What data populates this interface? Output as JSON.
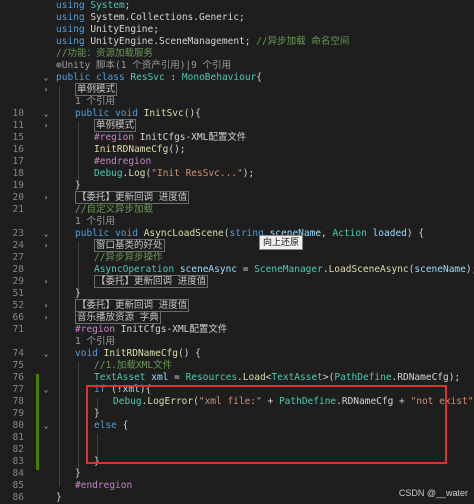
{
  "lines": [
    {
      "num": "",
      "fold": "",
      "indent": 0,
      "parts": [
        [
          "kw",
          "using"
        ],
        [
          "plain",
          " "
        ],
        [
          "ty",
          "System"
        ],
        [
          "plain",
          ";"
        ]
      ]
    },
    {
      "num": "",
      "fold": "",
      "indent": 0,
      "parts": [
        [
          "kw",
          "using"
        ],
        [
          "plain",
          " System.Collections.Generic;"
        ]
      ]
    },
    {
      "num": "",
      "fold": "",
      "indent": 0,
      "parts": [
        [
          "kw",
          "using"
        ],
        [
          "plain",
          " UnityEngine;"
        ]
      ]
    },
    {
      "num": "",
      "fold": "",
      "indent": 0,
      "parts": [
        [
          "kw",
          "using"
        ],
        [
          "plain",
          " UnityEngine.SceneManagement; "
        ],
        [
          "cm",
          "//异步加载 命名空间"
        ]
      ]
    },
    {
      "num": "",
      "fold": "",
      "indent": 0,
      "parts": [
        [
          "cm",
          "//功能：资源加载服务"
        ]
      ]
    },
    {
      "num": "",
      "fold": "",
      "indent": 0,
      "parts": [
        [
          "meta",
          "⊕Unity 脚本(1 个资产引用)|9 个引用"
        ]
      ]
    },
    {
      "num": "",
      "fold": "v",
      "indent": 0,
      "parts": [
        [
          "kw",
          "public"
        ],
        [
          "plain",
          " "
        ],
        [
          "kw",
          "class"
        ],
        [
          "plain",
          " "
        ],
        [
          "ty",
          "ResSvc"
        ],
        [
          "plain",
          " : "
        ],
        [
          "ty",
          "MonoBehaviour"
        ],
        [
          "plain",
          "{"
        ]
      ]
    },
    {
      "num": "",
      "fold": ">",
      "indent": 1,
      "parts": [
        [
          "boxed",
          "单例模式"
        ]
      ]
    },
    {
      "num": "",
      "fold": "",
      "indent": 1,
      "parts": [
        [
          "meta",
          "1 个引用"
        ]
      ]
    },
    {
      "num": "10",
      "fold": "v",
      "indent": 1,
      "parts": [
        [
          "kw",
          "public"
        ],
        [
          "plain",
          " "
        ],
        [
          "kw",
          "void"
        ],
        [
          "plain",
          " "
        ],
        [
          "fn",
          "InitSvc"
        ],
        [
          "plain",
          "(){"
        ]
      ]
    },
    {
      "num": "11",
      "fold": ">",
      "indent": 2,
      "parts": [
        [
          "boxed",
          "单例模式"
        ]
      ]
    },
    {
      "num": "15",
      "fold": "",
      "indent": 2,
      "parts": [
        [
          "pp",
          "#region"
        ],
        [
          "plain",
          " InitCfgs-XML配置文件"
        ]
      ]
    },
    {
      "num": "16",
      "fold": "",
      "indent": 2,
      "parts": [
        [
          "fn",
          "InitRDNameCfg"
        ],
        [
          "plain",
          "();"
        ]
      ]
    },
    {
      "num": "17",
      "fold": "",
      "indent": 2,
      "parts": [
        [
          "pp",
          "#endregion"
        ]
      ]
    },
    {
      "num": "18",
      "fold": "",
      "indent": 2,
      "parts": [
        [
          "ty",
          "Debug"
        ],
        [
          "plain",
          "."
        ],
        [
          "fn",
          "Log"
        ],
        [
          "plain",
          "("
        ],
        [
          "str",
          "\"Init ResSvc...\""
        ],
        [
          "plain",
          ");"
        ]
      ]
    },
    {
      "num": "19",
      "fold": "",
      "indent": 1,
      "parts": [
        [
          "plain",
          "}"
        ]
      ]
    },
    {
      "num": "20",
      "fold": ">",
      "indent": 1,
      "parts": [
        [
          "boxed",
          "【委托】更新回调 进度值"
        ]
      ]
    },
    {
      "num": "21",
      "fold": "",
      "indent": 1,
      "parts": [
        [
          "cm",
          "//自定义异步加载"
        ]
      ]
    },
    {
      "num": "",
      "fold": "",
      "indent": 1,
      "parts": [
        [
          "meta",
          "1 个引用"
        ]
      ]
    },
    {
      "num": "23",
      "fold": "v",
      "indent": 1,
      "parts": [
        [
          "kw",
          "public"
        ],
        [
          "plain",
          " "
        ],
        [
          "kw",
          "void"
        ],
        [
          "plain",
          " "
        ],
        [
          "fn",
          "AsyncLoadScene"
        ],
        [
          "plain",
          "("
        ],
        [
          "kw",
          "string"
        ],
        [
          "plain",
          " "
        ],
        [
          "id",
          "sceneName"
        ],
        [
          "plain",
          ", "
        ],
        [
          "ty",
          "Action"
        ],
        [
          "plain",
          " "
        ],
        [
          "id",
          "loaded"
        ],
        [
          "plain",
          ") {"
        ]
      ]
    },
    {
      "num": "24",
      "fold": ">",
      "indent": 2,
      "parts": [
        [
          "boxed",
          "窗口基类的好处"
        ]
      ]
    },
    {
      "num": "27",
      "fold": "",
      "indent": 2,
      "parts": [
        [
          "cm",
          "//异步异步操作"
        ]
      ]
    },
    {
      "num": "28",
      "fold": "",
      "indent": 2,
      "parts": [
        [
          "ty",
          "AsyncOperation"
        ],
        [
          "plain",
          " "
        ],
        [
          "id",
          "sceneAsync"
        ],
        [
          "plain",
          " = "
        ],
        [
          "ty",
          "SceneManager"
        ],
        [
          "plain",
          "."
        ],
        [
          "fn",
          "LoadSceneAsync"
        ],
        [
          "plain",
          "("
        ],
        [
          "id",
          "sceneName"
        ],
        [
          "plain",
          ");"
        ]
      ]
    },
    {
      "num": "29",
      "fold": ">",
      "indent": 2,
      "parts": [
        [
          "boxed",
          "【委托】更新回调 进度值"
        ]
      ]
    },
    {
      "num": "51",
      "fold": "",
      "indent": 1,
      "parts": [
        [
          "plain",
          "}"
        ]
      ]
    },
    {
      "num": "52",
      "fold": ">",
      "indent": 1,
      "parts": [
        [
          "boxed",
          "【委托】更新回调 进度值"
        ]
      ]
    },
    {
      "num": "66",
      "fold": ">",
      "indent": 1,
      "parts": [
        [
          "boxed",
          "音乐播放资源 字典"
        ]
      ]
    },
    {
      "num": "71",
      "fold": "",
      "indent": 1,
      "parts": [
        [
          "pp",
          "#region"
        ],
        [
          "plain",
          " InitCfgs-XML配置文件"
        ]
      ]
    },
    {
      "num": "",
      "fold": "",
      "indent": 1,
      "parts": [
        [
          "meta",
          "1 个引用"
        ]
      ]
    },
    {
      "num": "74",
      "fold": "v",
      "indent": 1,
      "parts": [
        [
          "kw",
          "void"
        ],
        [
          "plain",
          " "
        ],
        [
          "fn",
          "InitRDNameCfg"
        ],
        [
          "plain",
          "() {"
        ]
      ]
    },
    {
      "num": "75",
      "fold": "",
      "indent": 2,
      "parts": [
        [
          "cm",
          "//1.加载XML文件"
        ]
      ]
    },
    {
      "num": "76",
      "fold": "",
      "indent": 2,
      "parts": [
        [
          "ty",
          "TextAsset"
        ],
        [
          "plain",
          " "
        ],
        [
          "id",
          "xml"
        ],
        [
          "plain",
          " = "
        ],
        [
          "ty",
          "Resources"
        ],
        [
          "plain",
          "."
        ],
        [
          "fn",
          "Load"
        ],
        [
          "plain",
          "<"
        ],
        [
          "ty",
          "TextAsset"
        ],
        [
          "plain",
          ">("
        ],
        [
          "ty",
          "PathDefine"
        ],
        [
          "plain",
          ".RDNameCfg);"
        ]
      ]
    },
    {
      "num": "77",
      "fold": "v",
      "indent": 2,
      "parts": [
        [
          "kw",
          "if"
        ],
        [
          "plain",
          " (!"
        ],
        [
          "id",
          "xml"
        ],
        [
          "plain",
          ")"
        ],
        [
          "plain",
          "{"
        ]
      ]
    },
    {
      "num": "78",
      "fold": "",
      "indent": 3,
      "parts": [
        [
          "ty",
          "Debug"
        ],
        [
          "plain",
          "."
        ],
        [
          "fn",
          "LogError"
        ],
        [
          "plain",
          "("
        ],
        [
          "str",
          "\"xml file:\""
        ],
        [
          "plain",
          " + "
        ],
        [
          "ty",
          "PathDefine"
        ],
        [
          "plain",
          ".RDNameCfg + "
        ],
        [
          "str",
          "\"not exist\""
        ],
        [
          "plain",
          ");"
        ]
      ]
    },
    {
      "num": "79",
      "fold": "",
      "indent": 2,
      "parts": [
        [
          "plain",
          "}"
        ]
      ]
    },
    {
      "num": "80",
      "fold": "v",
      "indent": 2,
      "parts": [
        [
          "kw",
          "else"
        ],
        [
          "plain",
          " {"
        ]
      ]
    },
    {
      "num": "81",
      "fold": "",
      "indent": 2,
      "parts": [
        [
          "plain",
          ""
        ]
      ]
    },
    {
      "num": "82",
      "fold": "",
      "indent": 2,
      "parts": [
        [
          "plain",
          ""
        ]
      ]
    },
    {
      "num": "83",
      "fold": "",
      "indent": 2,
      "parts": [
        [
          "plain",
          "}"
        ]
      ]
    },
    {
      "num": "84",
      "fold": "",
      "indent": 1,
      "parts": [
        [
          "plain",
          "}"
        ]
      ]
    },
    {
      "num": "85",
      "fold": "",
      "indent": 1,
      "parts": [
        [
          "pp",
          "#endregion"
        ]
      ]
    },
    {
      "num": "86",
      "fold": "",
      "indent": 0,
      "parts": [
        [
          "plain",
          "}"
        ]
      ]
    }
  ],
  "tooltip": "向上还原",
  "watermark": "CSDN @__water"
}
